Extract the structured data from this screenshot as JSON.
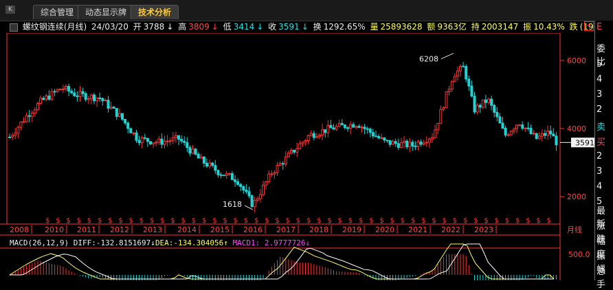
{
  "tabs": [
    {
      "label": "综合管理",
      "active": false
    },
    {
      "label": "动态显示牌",
      "active": false
    },
    {
      "label": "技术分析",
      "active": true
    }
  ],
  "instrument": {
    "name": "螺纹钢连续(月线)",
    "date": "24/03/20",
    "open_label": "开",
    "open": "3788",
    "high_label": "高",
    "high": "3809",
    "low_label": "低",
    "low": "3414",
    "close_label": "收",
    "close": "3591",
    "turnover_label": "换",
    "turnover": "1292.65%",
    "volume_label": "量",
    "volume": "25893628",
    "amount_label": "额",
    "amount": "9363亿",
    "position_label": "持",
    "position": "2003147",
    "amplitude_label": "振",
    "amplitude": "10.43%",
    "change_label": "跌",
    "change": "(19"
  },
  "price_axis": {
    "labels": [
      "6000",
      "4000",
      "2000"
    ],
    "current": "3591",
    "max_marker": "6208",
    "min_marker": "1618"
  },
  "years": [
    "2008",
    "2010",
    "2011",
    "2012",
    "2013",
    "2014",
    "2015",
    "2016",
    "2017",
    "2018",
    "2019",
    "2020",
    "2021",
    "2022",
    "2023"
  ],
  "period_label": "月线",
  "macd": {
    "title": "MACD(26,12,9)",
    "diff": "DIFF:-132.8151697",
    "dea": "DEA:-134.304056",
    "macd1": "MACD1: 2.9777726",
    "axis_label": "500.0"
  },
  "right_panel": [
    "E",
    "委比",
    "5",
    "4",
    "3",
    "2",
    "卖",
    "买",
    "2",
    "3",
    "4",
    "5",
    "最新",
    "涨跌",
    "幅度",
    "振幅",
    "总手"
  ],
  "colors": {
    "up": "#ff3333",
    "down": "#22d3d3",
    "ma": "#ffffff",
    "diff": "#ffff66",
    "dea": "#ffffff"
  }
}
